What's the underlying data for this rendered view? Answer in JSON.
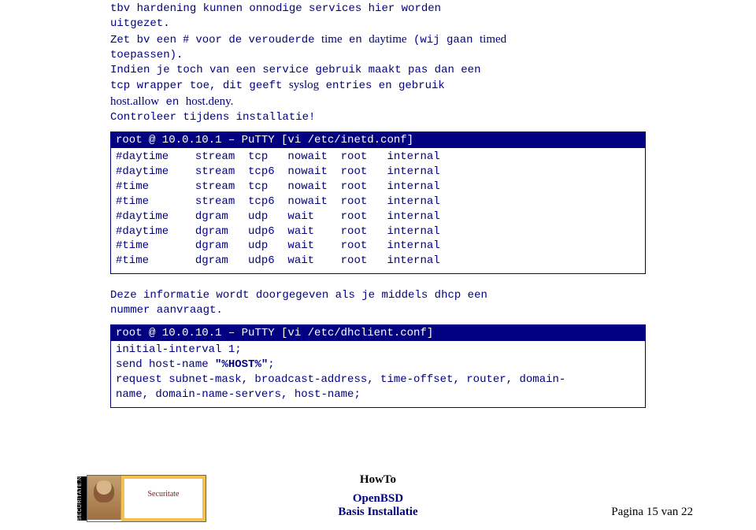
{
  "intro": {
    "l1": "tbv hardening kunnen onnodige services hier worden",
    "l2": "uitgezet.",
    "l3a": "Zet bv een ",
    "hash": "#",
    "l3b": " voor de verouderde ",
    "time": "time",
    "en1": " en ",
    "daytime": "daytime",
    "l3c": " (wij gaan ",
    "timed": "timed",
    "l4": "toepassen).",
    "l5": "Indien je toch van een service gebruik maakt pas dan een",
    "l6a": "tcp wrapper toe, dit geeft ",
    "syslog": "syslog",
    "l6b": " entries en gebruik",
    "hostallow": "host.allow",
    "en2": " en ",
    "hostdeny": "host.deny.",
    "l8": "Controleer tijdens installatie!"
  },
  "box1": {
    "header": "root @ 10.0.10.1 – PuTTY [vi /etc/inetd.conf]",
    "rows": [
      [
        "#daytime",
        "stream",
        "tcp",
        "nowait",
        "root",
        "internal"
      ],
      [
        "#daytime",
        "stream",
        "tcp6",
        "nowait",
        "root",
        "internal"
      ],
      [
        "#time",
        "stream",
        "tcp",
        "nowait",
        "root",
        "internal"
      ],
      [
        "#time",
        "stream",
        "tcp6",
        "nowait",
        "root",
        "internal"
      ],
      [
        "#daytime",
        "dgram",
        "udp",
        "wait",
        "root",
        "internal"
      ],
      [
        "#daytime",
        "dgram",
        "udp6",
        "wait",
        "root",
        "internal"
      ],
      [
        "#time",
        "dgram",
        "udp",
        "wait",
        "root",
        "internal"
      ],
      [
        "#time",
        "dgram",
        "udp6",
        "wait",
        "root",
        "internal"
      ]
    ]
  },
  "mid": {
    "l1": "Deze informatie wordt doorgegeven als je middels dhcp een",
    "l2": "nummer aanvraagt."
  },
  "box2": {
    "header": "root @ 10.0.10.1 – PuTTY [vi /etc/dhclient.conf]",
    "l1": "initial-interval 1;",
    "l2a": "send host-name ",
    "l2b": "\"%HOST%\"",
    "l2c": ";",
    "l3": "request subnet-mask, broadcast-address, time-offset, router, domain-",
    "l4": "name, domain-name-servers, host-name;"
  },
  "footer": {
    "howto": "HowTo",
    "t2": "OpenBSD",
    "t3": "Basis Installatie",
    "page": "Pagina 15 van 22",
    "strip": "SECURITATE.NI"
  }
}
